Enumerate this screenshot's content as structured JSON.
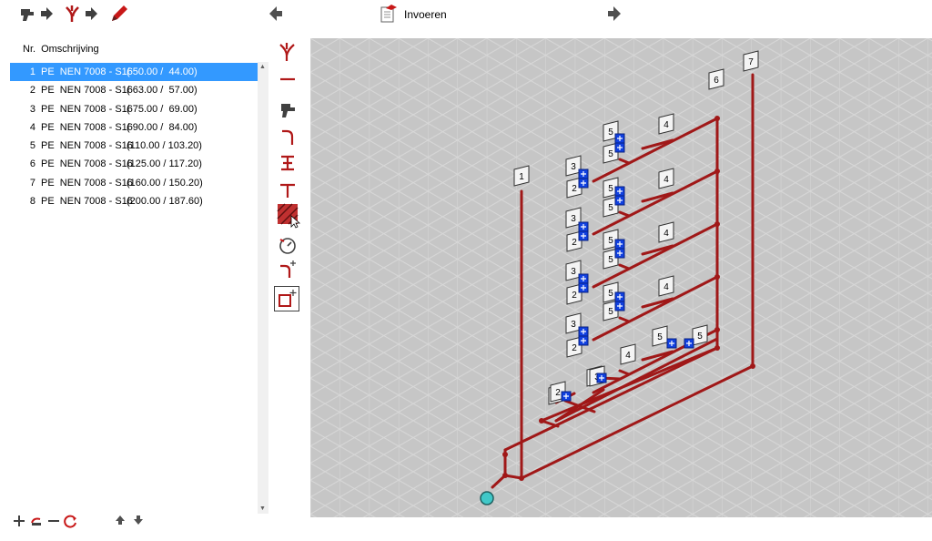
{
  "toolbar": {
    "items": [
      {
        "name": "toilet-forward-icon"
      },
      {
        "name": "fitting-forward-icon"
      },
      {
        "name": "pencil-icon"
      },
      {
        "name": "back-arrow-icon"
      },
      {
        "name": "document-icon",
        "label": "Invoeren"
      },
      {
        "name": "forward-arrow-icon"
      }
    ]
  },
  "list": {
    "headers": {
      "nr": "Nr.",
      "desc": "Omschrijving"
    },
    "rows": [
      {
        "nr": "1",
        "desc": "PE  NEN 7008 - S16",
        "dim": "( 50.00 /  44.00)"
      },
      {
        "nr": "2",
        "desc": "PE  NEN 7008 - S16",
        "dim": "( 63.00 /  57.00)"
      },
      {
        "nr": "3",
        "desc": "PE  NEN 7008 - S16",
        "dim": "( 75.00 /  69.00)"
      },
      {
        "nr": "4",
        "desc": "PE  NEN 7008 - S16",
        "dim": "( 90.00 /  84.00)"
      },
      {
        "nr": "5",
        "desc": "PE  NEN 7008 - S16",
        "dim": "(110.00 / 103.20)"
      },
      {
        "nr": "6",
        "desc": "PE  NEN 7008 - S16",
        "dim": "(125.00 / 117.20)"
      },
      {
        "nr": "7",
        "desc": "PE  NEN 7008 - S16",
        "dim": "(160.00 / 150.20)"
      },
      {
        "nr": "8",
        "desc": "PE  NEN 7008 - S16",
        "dim": "(200.00 / 187.60)"
      }
    ],
    "selected_index": 0
  },
  "side_tools": [
    "branch-fitting-icon",
    "straight-pipe-icon",
    "toilet-icon",
    "bend-icon",
    "reducer-icon",
    "tee-icon",
    "hatch-tool-icon",
    "gauge-icon",
    "add-bend-icon",
    "add-box-icon"
  ],
  "diagram": {
    "pipe_color": "#a01818",
    "grid_bg": "#c6c6c6",
    "tags": [
      {
        "text": "7"
      },
      {
        "text": "6"
      },
      {
        "text": "1"
      },
      {
        "text": "4"
      },
      {
        "text": "5"
      },
      {
        "text": "5"
      },
      {
        "text": "3"
      },
      {
        "text": "2"
      },
      {
        "text": "4"
      },
      {
        "text": "5"
      },
      {
        "text": "5"
      },
      {
        "text": "3"
      },
      {
        "text": "2"
      },
      {
        "text": "4"
      },
      {
        "text": "5"
      },
      {
        "text": "5"
      },
      {
        "text": "3"
      },
      {
        "text": "2"
      },
      {
        "text": "4"
      },
      {
        "text": "5"
      },
      {
        "text": "5"
      },
      {
        "text": "3"
      },
      {
        "text": "2"
      },
      {
        "text": "3"
      },
      {
        "text": "2"
      },
      {
        "text": "5"
      },
      {
        "text": "5"
      },
      {
        "text": "4"
      },
      {
        "text": "3"
      },
      {
        "text": "2"
      }
    ]
  },
  "bottom_tools": [
    "add-icon",
    "undo-icon",
    "remove-icon",
    "refresh-icon",
    "move-up-icon",
    "move-down-icon"
  ]
}
